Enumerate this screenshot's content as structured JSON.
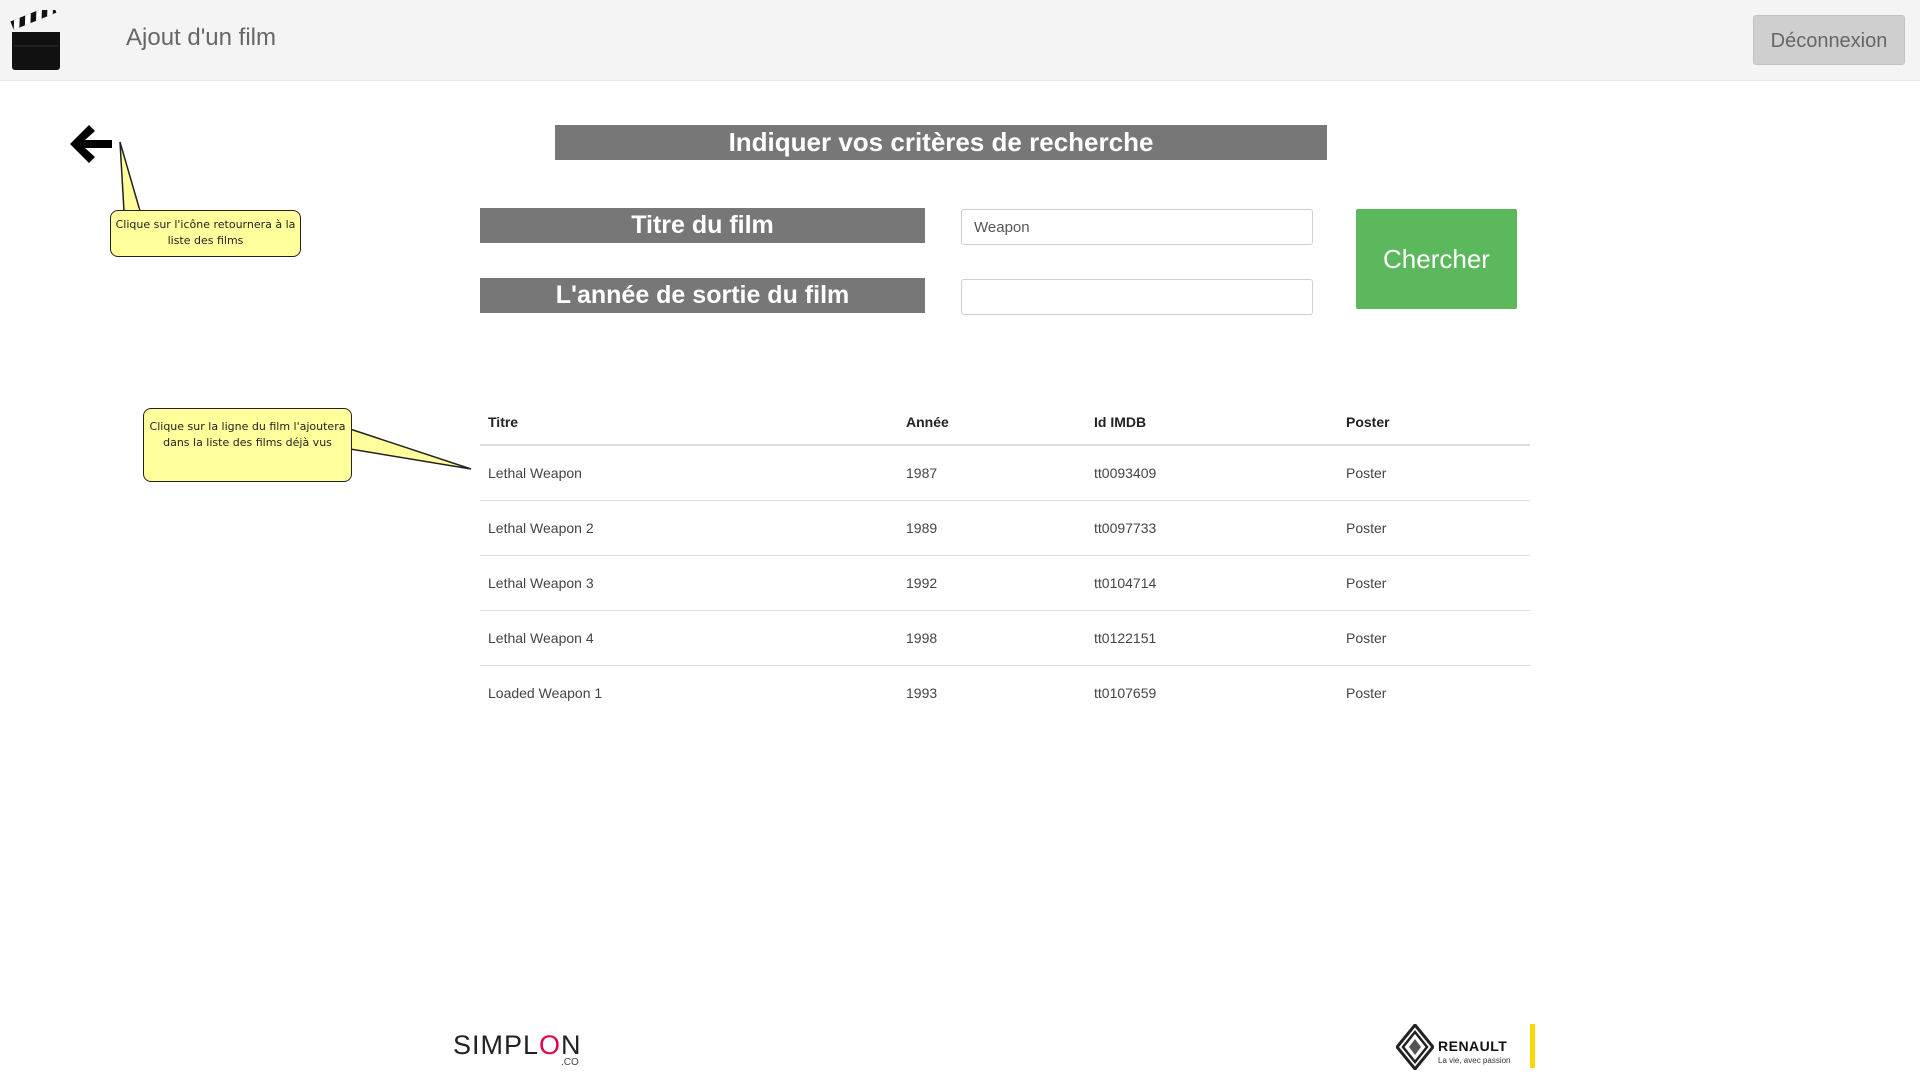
{
  "header": {
    "title": "Ajout d'un film",
    "logout_label": "Déconnexion",
    "logo_icon": "clapperboard-icon"
  },
  "back": {
    "icon": "arrow-left-icon"
  },
  "callouts": {
    "back_note": "Clique sur l'icône retournera à la liste des films",
    "row_note": "Clique sur la ligne du film l'ajoutera dans la liste des films déjà vus"
  },
  "search": {
    "heading": "Indiquer vos critères de recherche",
    "title_label": "Titre du film",
    "title_value": "Weapon",
    "year_label": "L'année de sortie du film",
    "year_value": "",
    "button_label": "Chercher"
  },
  "table": {
    "headers": [
      "Titre",
      "Année",
      "Id IMDB",
      "Poster"
    ],
    "rows": [
      {
        "title": "Lethal Weapon",
        "year": "1987",
        "imdb": "tt0093409",
        "poster": "Poster"
      },
      {
        "title": "Lethal Weapon 2",
        "year": "1989",
        "imdb": "tt0097733",
        "poster": "Poster"
      },
      {
        "title": "Lethal Weapon 3",
        "year": "1992",
        "imdb": "tt0104714",
        "poster": "Poster"
      },
      {
        "title": "Lethal Weapon 4",
        "year": "1998",
        "imdb": "tt0122151",
        "poster": "Poster"
      },
      {
        "title": "Loaded Weapon 1",
        "year": "1993",
        "imdb": "tt0107659",
        "poster": "Poster"
      }
    ]
  },
  "footer": {
    "simplon_text_a": "SIMPL",
    "simplon_text_o": "O",
    "simplon_text_b": "N",
    "simplon_suffix": ".CO",
    "renault_name": "RENAULT",
    "renault_tagline": "La vie, avec passion"
  },
  "colors": {
    "header_bg": "#f4f4f4",
    "label_bg": "#777777",
    "search_button": "#5cb85c",
    "callout_bg": "#ffff9c",
    "simplon_accent": "#e0004d",
    "renault_yellow": "#fbd700"
  }
}
